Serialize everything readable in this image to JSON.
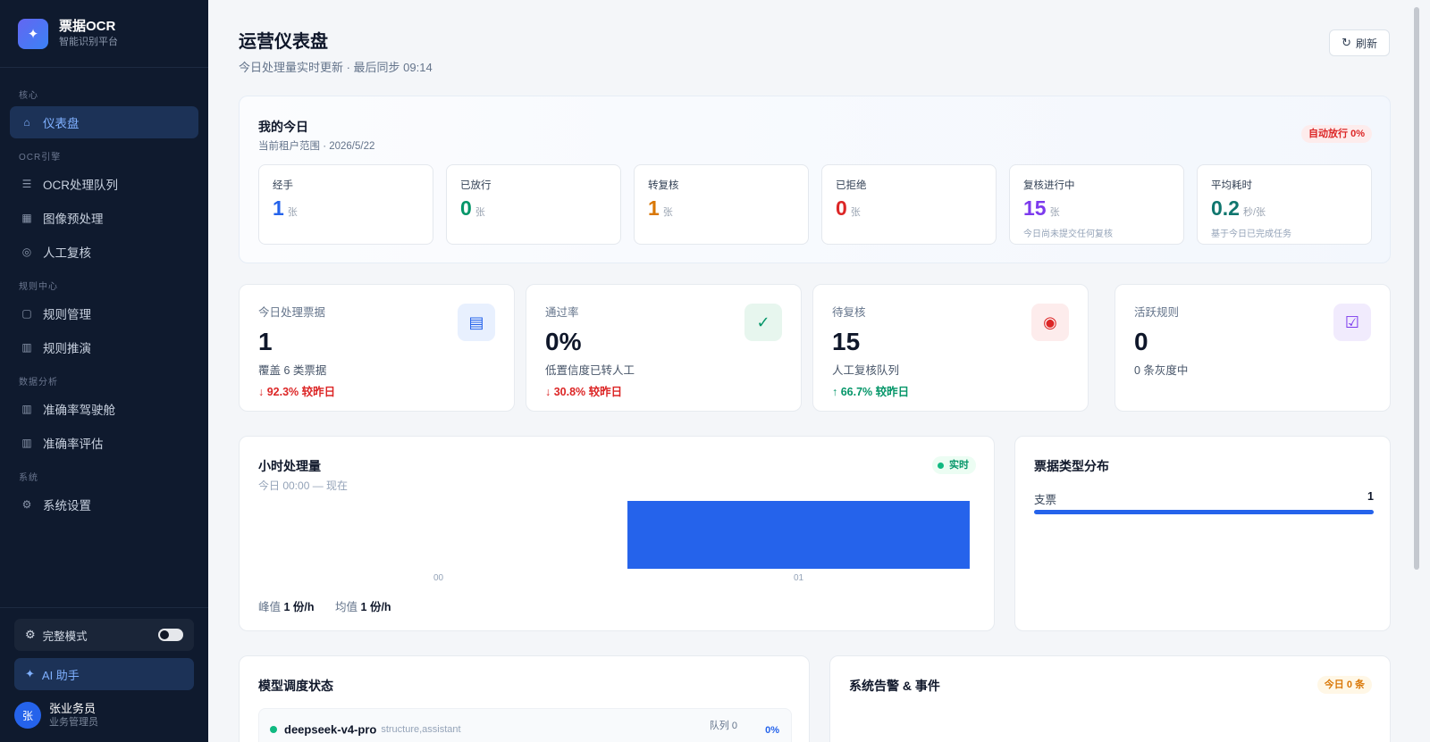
{
  "brand": {
    "name": "票据OCR",
    "subtitle": "智能识别平台",
    "logo_icon": "sparkle-icon"
  },
  "nav": {
    "groups": [
      {
        "label": "核心",
        "items": [
          {
            "label": "仪表盘",
            "icon": "home-icon",
            "active": true
          }
        ]
      },
      {
        "label": "OCR引擎",
        "items": [
          {
            "label": "OCR处理队列",
            "icon": "list-icon"
          },
          {
            "label": "图像预处理",
            "icon": "image-grid-icon"
          },
          {
            "label": "人工复核",
            "icon": "eye-icon"
          }
        ]
      },
      {
        "label": "规则中心",
        "items": [
          {
            "label": "规则管理",
            "icon": "clipboard-icon"
          },
          {
            "label": "规则推演",
            "icon": "bar-chart-icon"
          }
        ]
      },
      {
        "label": "数据分析",
        "items": [
          {
            "label": "准确率驾驶舱",
            "icon": "bar-chart-icon"
          },
          {
            "label": "准确率评估",
            "icon": "bar-chart-icon"
          }
        ]
      },
      {
        "label": "系统",
        "items": [
          {
            "label": "系统设置",
            "icon": "gear-icon"
          }
        ]
      }
    ]
  },
  "sidebar_bottom": {
    "mode_label": "完整模式",
    "mode_enabled": false,
    "ai_label": "AI 助手",
    "user": {
      "avatar": "张",
      "name": "张业务员",
      "role": "业务管理员"
    }
  },
  "header": {
    "title": "运营仪表盘",
    "subtitle": "今日处理量实时更新 · 最后同步 09:14",
    "refresh_label": "刷新"
  },
  "today": {
    "title": "我的今日",
    "subtitle": "当前租户范围 · 2026/5/22",
    "badge": "自动放行 0%",
    "cards": [
      {
        "label": "经手",
        "value": "1",
        "unit": "张",
        "color": "#2563eb",
        "note": ""
      },
      {
        "label": "已放行",
        "value": "0",
        "unit": "张",
        "color": "#059669",
        "note": ""
      },
      {
        "label": "转复核",
        "value": "1",
        "unit": "张",
        "color": "#d97706",
        "note": ""
      },
      {
        "label": "已拒绝",
        "value": "0",
        "unit": "张",
        "color": "#dc2626",
        "note": ""
      },
      {
        "label": "复核进行中",
        "value": "15",
        "unit": "张",
        "color": "#7c3aed",
        "note": "今日尚未提交任何复核"
      },
      {
        "label": "平均耗时",
        "value": "0.2",
        "unit": "秒/张",
        "color": "#0f766e",
        "note": "基于今日已完成任务"
      }
    ]
  },
  "stats": [
    {
      "label": "今日处理票据",
      "value": "1",
      "desc": "覆盖 6 类票据",
      "trend": "↓ 92.3% 较昨日",
      "trend_color": "#dc2626",
      "icon": "document-icon",
      "icon_glyph": "▤",
      "icon_bg": "#e8f0fe",
      "icon_color": "#2563eb"
    },
    {
      "label": "通过率",
      "value": "0%",
      "desc": "低置信度已转人工",
      "trend": "↓ 30.8% 较昨日",
      "trend_color": "#dc2626",
      "icon": "check-icon",
      "icon_glyph": "✓",
      "icon_bg": "#e7f6ee",
      "icon_color": "#059669"
    },
    {
      "label": "待复核",
      "value": "15",
      "desc": "人工复核队列",
      "trend": "↑ 66.7% 较昨日",
      "trend_color": "#059669",
      "icon": "eye-icon",
      "icon_glyph": "◉",
      "icon_bg": "#fdecec",
      "icon_color": "#dc2626"
    },
    {
      "label": "活跃规则",
      "value": "0",
      "desc": "0 条灰度中",
      "trend": "",
      "trend_color": "#64748b",
      "icon": "clipboard-check-icon",
      "icon_glyph": "☑",
      "icon_bg": "#f1ebfd",
      "icon_color": "#7c3aed"
    }
  ],
  "hourly": {
    "title": "小时处理量",
    "subtitle": "今日 00:00 — 现在",
    "badge": "实时",
    "peak_label": "峰值",
    "peak_value": "1 份/h",
    "avg_label": "均值",
    "avg_value": "1 份/h"
  },
  "chart_data": {
    "type": "bar",
    "categories": [
      "00",
      "01"
    ],
    "values": [
      0,
      1
    ],
    "ylim": [
      0,
      1
    ],
    "color": "#2563eb",
    "grid": false,
    "legend": "none"
  },
  "distribution": {
    "title": "票据类型分布",
    "items": [
      {
        "label": "支票",
        "count": "1",
        "share": 1.0
      }
    ]
  },
  "models": {
    "title": "模型调度状态",
    "rows": [
      {
        "name": "deepseek-v4-pro",
        "tags": "structure,assistant",
        "queue": "队列 0",
        "pct": "0%"
      }
    ]
  },
  "alerts": {
    "title": "系统告警 & 事件",
    "badge": "今日 0 条"
  }
}
